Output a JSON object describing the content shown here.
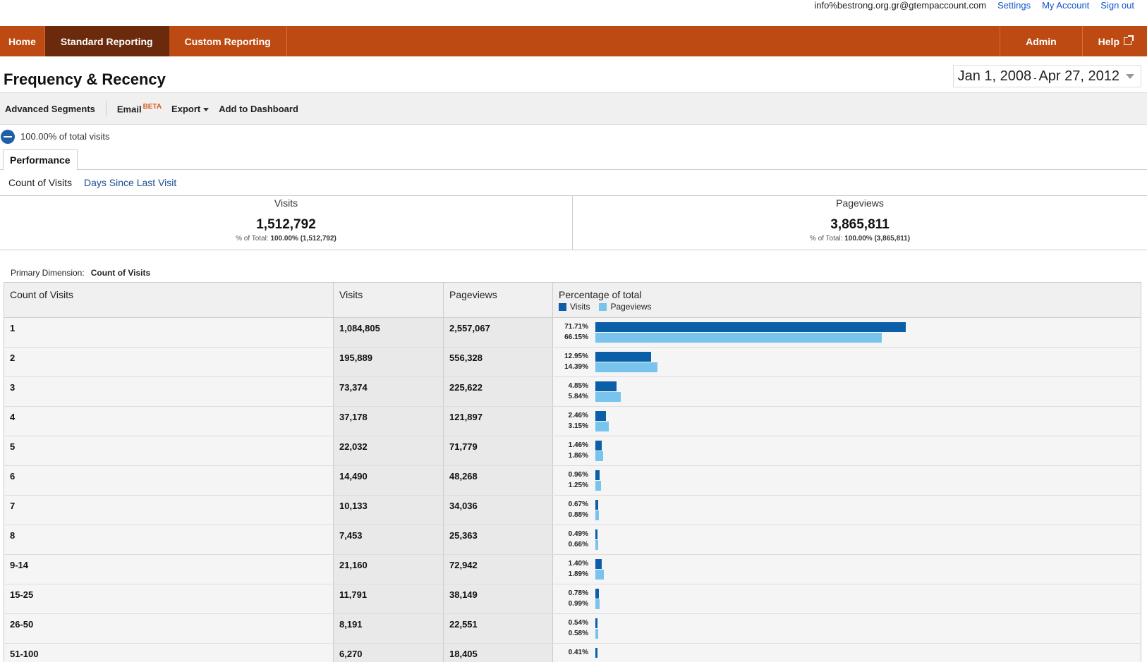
{
  "account": {
    "email": "info%bestrong.org.gr@gtempaccount.com",
    "settings": "Settings",
    "my_account": "My Account",
    "sign_out": "Sign out"
  },
  "nav": {
    "home": "Home",
    "standard_reporting": "Standard Reporting",
    "custom_reporting": "Custom Reporting",
    "admin": "Admin",
    "help": "Help"
  },
  "page": {
    "title": "Frequency & Recency",
    "date_start": "Jan 1, 2008",
    "date_sep": "-",
    "date_end": "Apr 27, 2012"
  },
  "toolbar": {
    "advanced_segments": "Advanced Segments",
    "email": "Email",
    "beta": "BETA",
    "export": "Export",
    "add_to_dashboard": "Add to Dashboard"
  },
  "segment": {
    "label": "100.00% of total visits"
  },
  "tabs": {
    "performance": "Performance"
  },
  "explorer": {
    "current": "Count of Visits",
    "other": "Days Since Last Visit"
  },
  "scorecards": [
    {
      "label": "Visits",
      "value": "1,512,792",
      "pct_prefix": "% of Total:",
      "pct": "100.00%",
      "pct_total": "(1,512,792)"
    },
    {
      "label": "Pageviews",
      "value": "3,865,811",
      "pct_prefix": "% of Total:",
      "pct": "100.00%",
      "pct_total": "(3,865,811)"
    }
  ],
  "primary_dimension": {
    "label": "Primary Dimension:",
    "value": "Count of Visits"
  },
  "table": {
    "headers": {
      "dimension": "Count of Visits",
      "visits": "Visits",
      "pageviews": "Pageviews",
      "percentage": "Percentage of total",
      "legend_visits": "Visits",
      "legend_pageviews": "Pageviews"
    },
    "colors": {
      "visits": "#0b5ea8",
      "pageviews": "#79c4ec"
    },
    "rows": [
      {
        "dim": "1",
        "visits": "1,084,805",
        "pageviews": "2,557,067",
        "pct_visits": "71.71%",
        "pct_pageviews": "66.15%",
        "v": 71.71,
        "p": 66.15
      },
      {
        "dim": "2",
        "visits": "195,889",
        "pageviews": "556,328",
        "pct_visits": "12.95%",
        "pct_pageviews": "14.39%",
        "v": 12.95,
        "p": 14.39
      },
      {
        "dim": "3",
        "visits": "73,374",
        "pageviews": "225,622",
        "pct_visits": "4.85%",
        "pct_pageviews": "5.84%",
        "v": 4.85,
        "p": 5.84
      },
      {
        "dim": "4",
        "visits": "37,178",
        "pageviews": "121,897",
        "pct_visits": "2.46%",
        "pct_pageviews": "3.15%",
        "v": 2.46,
        "p": 3.15
      },
      {
        "dim": "5",
        "visits": "22,032",
        "pageviews": "71,779",
        "pct_visits": "1.46%",
        "pct_pageviews": "1.86%",
        "v": 1.46,
        "p": 1.86
      },
      {
        "dim": "6",
        "visits": "14,490",
        "pageviews": "48,268",
        "pct_visits": "0.96%",
        "pct_pageviews": "1.25%",
        "v": 0.96,
        "p": 1.25
      },
      {
        "dim": "7",
        "visits": "10,133",
        "pageviews": "34,036",
        "pct_visits": "0.67%",
        "pct_pageviews": "0.88%",
        "v": 0.67,
        "p": 0.88
      },
      {
        "dim": "8",
        "visits": "7,453",
        "pageviews": "25,363",
        "pct_visits": "0.49%",
        "pct_pageviews": "0.66%",
        "v": 0.49,
        "p": 0.66
      },
      {
        "dim": "9-14",
        "visits": "21,160",
        "pageviews": "72,942",
        "pct_visits": "1.40%",
        "pct_pageviews": "1.89%",
        "v": 1.4,
        "p": 1.89
      },
      {
        "dim": "15-25",
        "visits": "11,791",
        "pageviews": "38,149",
        "pct_visits": "0.78%",
        "pct_pageviews": "0.99%",
        "v": 0.78,
        "p": 0.99
      },
      {
        "dim": "26-50",
        "visits": "8,191",
        "pageviews": "22,551",
        "pct_visits": "0.54%",
        "pct_pageviews": "0.58%",
        "v": 0.54,
        "p": 0.58
      },
      {
        "dim": "51-100",
        "visits": "6,270",
        "pageviews": "18,405",
        "pct_visits": "0.41%",
        "pct_pageviews": "",
        "v": 0.41,
        "p": 0
      }
    ]
  }
}
